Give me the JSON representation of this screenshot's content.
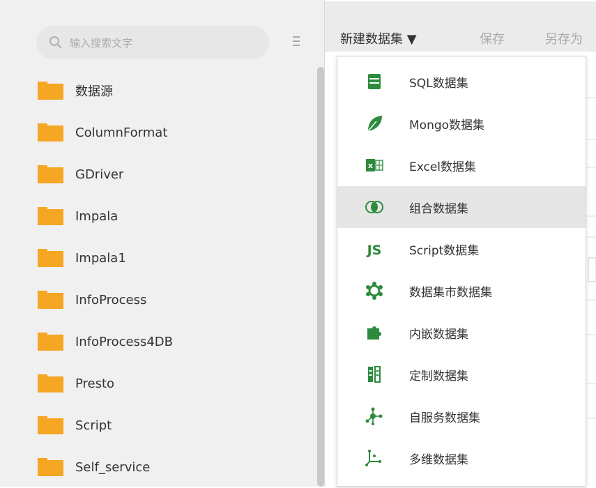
{
  "search": {
    "placeholder": "输入搜索文字"
  },
  "tree": {
    "items": [
      {
        "label": "数据源"
      },
      {
        "label": "ColumnFormat"
      },
      {
        "label": "GDriver"
      },
      {
        "label": "Impala"
      },
      {
        "label": "Impala1"
      },
      {
        "label": "InfoProcess"
      },
      {
        "label": "InfoProcess4DB"
      },
      {
        "label": "Presto"
      },
      {
        "label": "Script"
      },
      {
        "label": "Self_service"
      }
    ]
  },
  "toolbar": {
    "new_label": "新建数据集 ▼",
    "save_label": "保存",
    "save_as_label": "另存为"
  },
  "dropdown": {
    "items": [
      {
        "label": "SQL数据集",
        "icon": "sql-table-icon"
      },
      {
        "label": "Mongo数据集",
        "icon": "mongo-leaf-icon"
      },
      {
        "label": "Excel数据集",
        "icon": "excel-icon"
      },
      {
        "label": "组合数据集",
        "icon": "combine-circles-icon",
        "active": true
      },
      {
        "label": "Script数据集",
        "icon": "js-icon"
      },
      {
        "label": "数据集市数据集",
        "icon": "datamart-gear-icon"
      },
      {
        "label": "内嵌数据集",
        "icon": "embedded-puzzle-icon"
      },
      {
        "label": "定制数据集",
        "icon": "custom-columns-icon"
      },
      {
        "label": "自服务数据集",
        "icon": "self-service-nodes-icon"
      },
      {
        "label": "多维数据集",
        "icon": "multidim-cube-icon"
      }
    ]
  },
  "colors": {
    "folder": "#f5a623",
    "accent_green": "#2e8b3d",
    "sidebar_bg": "#f0f0f0",
    "toolbar_bg": "#ebebeb",
    "active_item_bg": "#e6e6e6"
  }
}
